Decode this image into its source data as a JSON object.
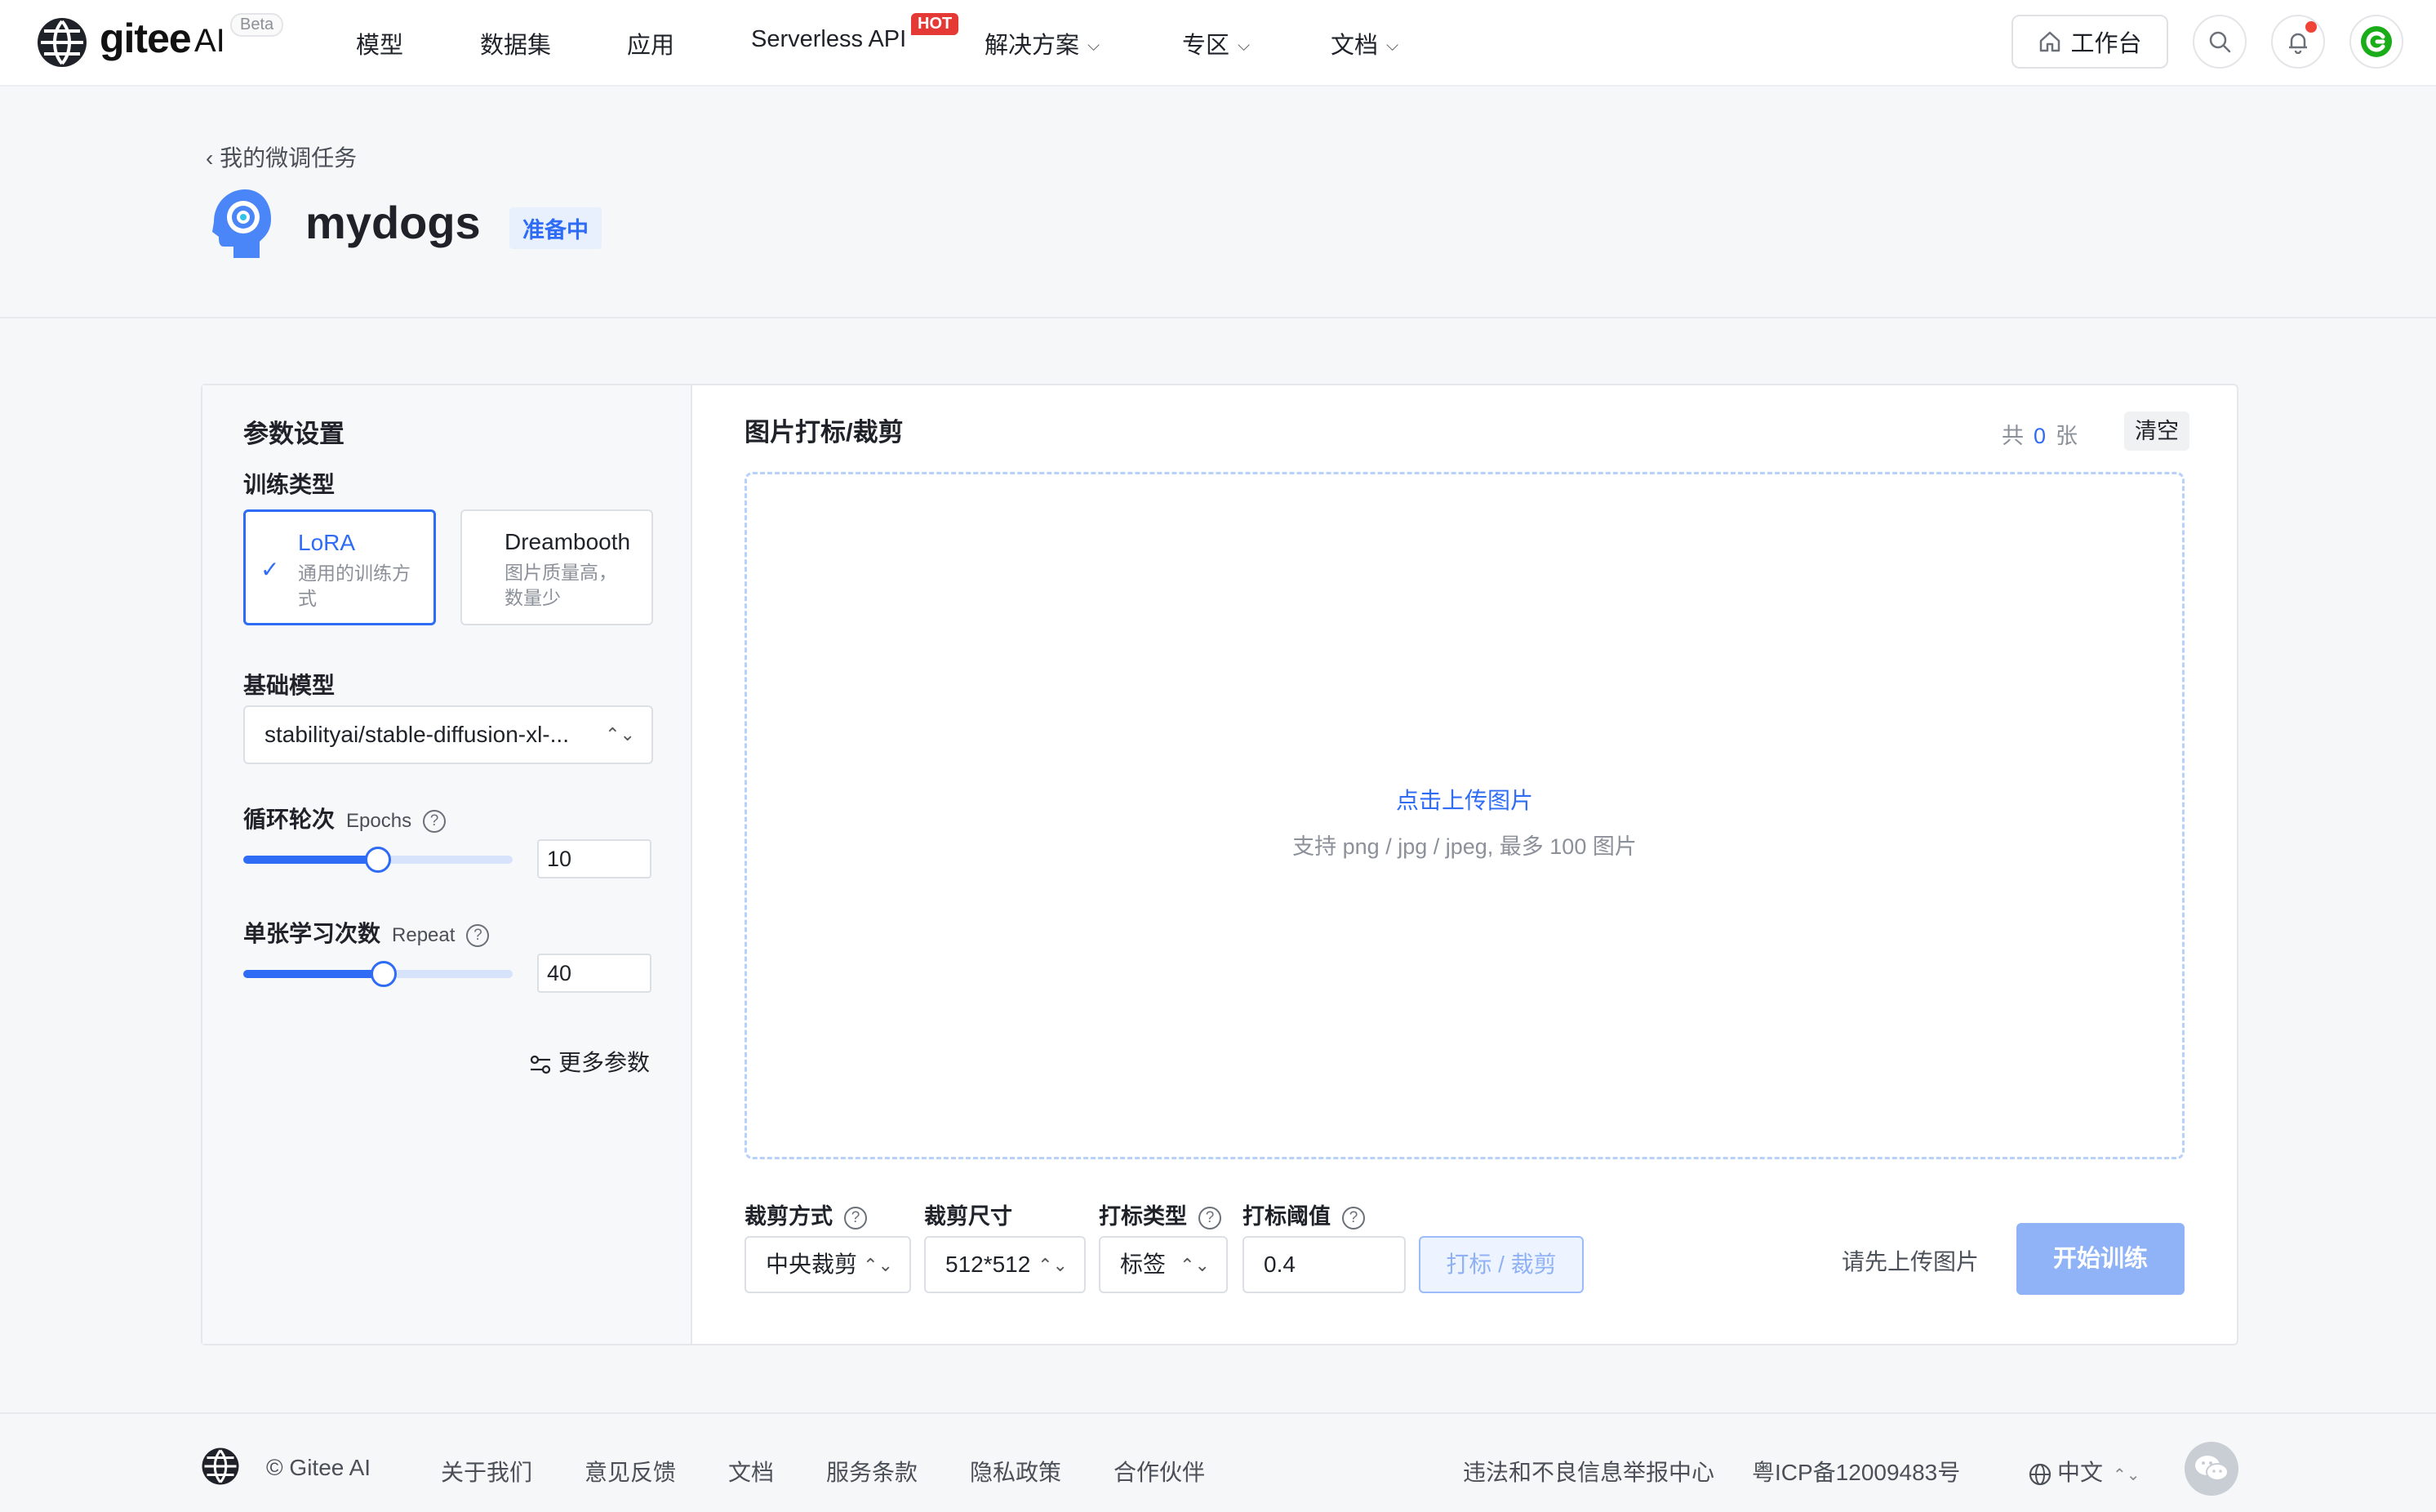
{
  "brand": {
    "name": "gitee",
    "ai": "AI",
    "beta": "Beta"
  },
  "nav": {
    "items": [
      {
        "label": "模型"
      },
      {
        "label": "数据集"
      },
      {
        "label": "应用"
      },
      {
        "label": "Serverless API",
        "badge": "HOT"
      },
      {
        "label": "解决方案"
      },
      {
        "label": "专区"
      },
      {
        "label": "文档"
      }
    ],
    "workbench": "工作台"
  },
  "header": {
    "back": "我的微调任务",
    "title": "mydogs",
    "status": "准备中"
  },
  "params": {
    "title": "参数设置",
    "train_type_label": "训练类型",
    "types": [
      {
        "name": "LoRA",
        "desc": "通用的训练方式",
        "selected": true
      },
      {
        "name": "Dreambooth",
        "desc": "图片质量高，数量少",
        "selected": false
      }
    ],
    "base_model_label": "基础模型",
    "base_model_value": "stabilityai/stable-diffusion-xl-...",
    "epochs": {
      "label": "循环轮次",
      "sub": "Epochs",
      "value": "10",
      "fill": 0.5
    },
    "repeat": {
      "label": "单张学习次数",
      "sub": "Repeat",
      "value": "40",
      "fill": 0.52
    },
    "more": "更多参数"
  },
  "images": {
    "title": "图片打标/裁剪",
    "count_prefix": "共",
    "count": "0",
    "count_suffix": "张",
    "clear": "清空",
    "upload_link": "点击上传图片",
    "upload_hint": "支持 png / jpg / jpeg, 最多 100 图片",
    "crop_mode_label": "裁剪方式",
    "crop_mode_value": "中央裁剪",
    "crop_size_label": "裁剪尺寸",
    "crop_size_value": "512*512",
    "tag_type_label": "打标类型",
    "tag_type_value": "标签",
    "threshold_label": "打标阈值",
    "threshold_value": "0.4",
    "tag_crop_button": "打标 / 裁剪",
    "hint": "请先上传图片",
    "train_button": "开始训练"
  },
  "footer": {
    "copyright": "© Gitee AI",
    "links": [
      "关于我们",
      "意见反馈",
      "文档",
      "服务条款",
      "隐私政策",
      "合作伙伴"
    ],
    "report": "违法和不良信息举报中心",
    "icp": "粤ICP备12009483号",
    "language": "中文"
  }
}
